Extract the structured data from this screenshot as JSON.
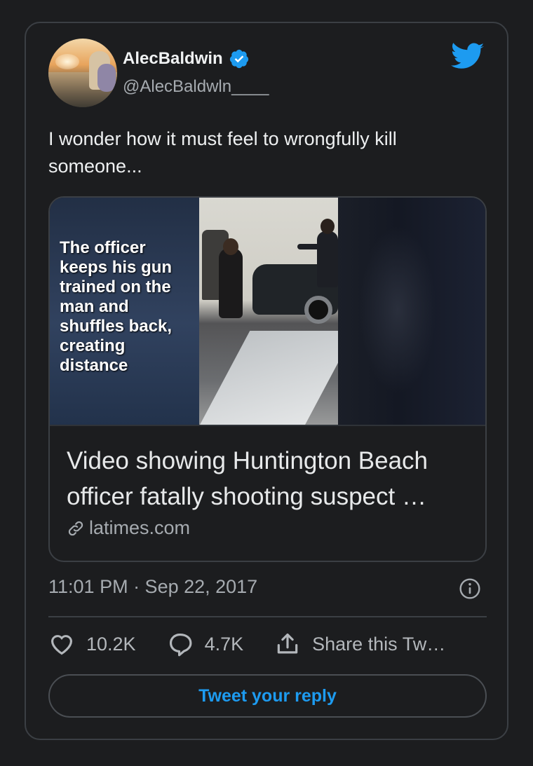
{
  "author": {
    "name": "AlecBaldwin",
    "handle": "@AlecBaldwln____",
    "verified": true,
    "avatar_icon": "avatar-photo"
  },
  "brand": {
    "icon": "twitter-bird-icon",
    "color": "#1d9bf0"
  },
  "tweet": {
    "text": "I wonder how it must feel to wrongfully kill someone..."
  },
  "link_card": {
    "media_overlay_text": "The officer keeps his gun trained on the man and shuffles back, creating distance",
    "title": "Video showing Huntington Beach officer fatally shooting suspect …",
    "domain": "latimes.com",
    "domain_icon": "link-icon"
  },
  "meta": {
    "timestamp": "11:01 PM · Sep 22, 2017",
    "info_icon": "info-icon"
  },
  "actions": {
    "likes": "10.2K",
    "replies": "4.7K",
    "share_label": "Share this Tw…"
  },
  "reply_button": {
    "label": "Tweet your reply"
  },
  "colors": {
    "background": "#1c1d1f",
    "border": "#3b3f44",
    "accent": "#1d9bf0",
    "text_primary": "#e7e9ea",
    "text_secondary": "#a6abb0"
  }
}
